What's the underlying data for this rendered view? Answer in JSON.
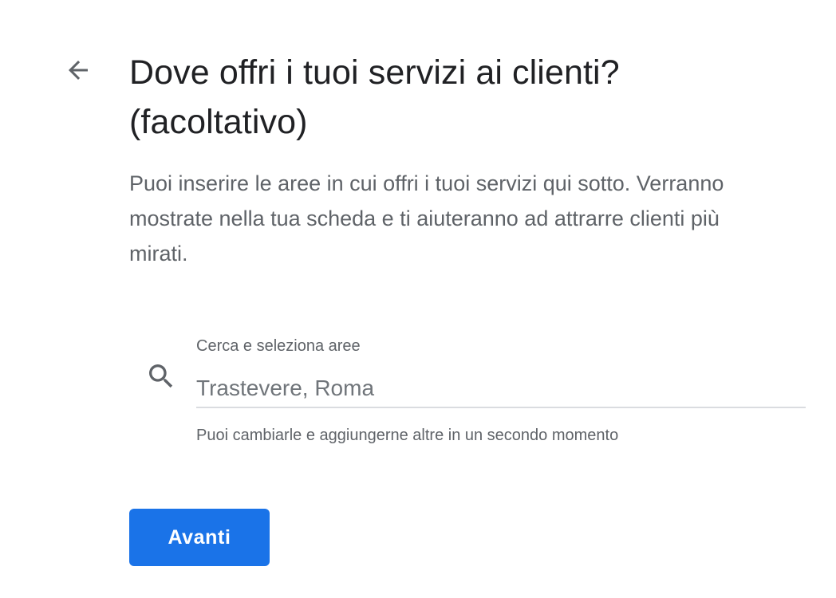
{
  "colors": {
    "accent": "#1a73e8",
    "title": "#202124",
    "secondary_text": "#5f6368",
    "icon": "#5f6368",
    "divider": "#dadce0"
  },
  "header": {
    "back_icon": "arrow-back-icon",
    "title": "Dove offri i tuoi servizi ai clienti? (facoltativo)"
  },
  "description": "Puoi inserire le aree in cui offri i tuoi servizi qui sotto. Verranno mostrate nella tua scheda e ti aiuteranno ad attrarre clienti più mirati.",
  "search": {
    "icon": "search-icon",
    "label": "Cerca e seleziona aree",
    "value": "",
    "placeholder": "Trastevere, Roma",
    "helper": "Puoi cambiarle e aggiungerne altre in un secondo momento"
  },
  "actions": {
    "next_label": "Avanti"
  }
}
